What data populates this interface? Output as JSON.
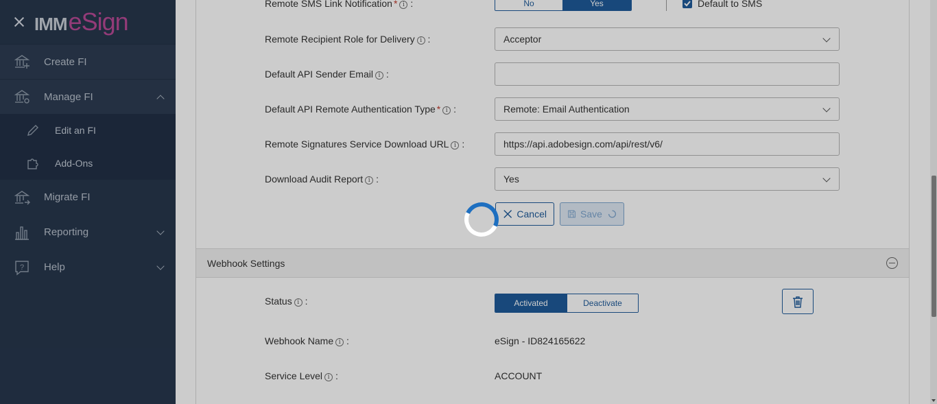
{
  "sidebar": {
    "logo_imm": "IMM",
    "logo_esign": "eSign",
    "items": [
      {
        "label": "Create FI",
        "icon": "bank-plus-icon"
      },
      {
        "label": "Manage FI",
        "icon": "bank-gear-icon"
      },
      {
        "label": "Edit an FI",
        "icon": "pencil-icon"
      },
      {
        "label": "Add-Ons",
        "icon": "puzzle-icon"
      },
      {
        "label": "Migrate FI",
        "icon": "bank-arrow-icon"
      },
      {
        "label": "Reporting",
        "icon": "bar-chart-icon"
      },
      {
        "label": "Help",
        "icon": "help-icon"
      }
    ]
  },
  "form": {
    "sms_label": "Remote SMS Link Notification",
    "sms_no": "No",
    "sms_yes": "Yes",
    "default_sms_label": "Default to SMS",
    "role_label": "Remote Recipient Role for Delivery",
    "role_value": "Acceptor",
    "sender_label": "Default API Sender Email",
    "sender_value": "",
    "auth_label": "Default API Remote Authentication Type",
    "auth_value": "Remote: Email Authentication",
    "url_label": "Remote Signatures Service Download URL",
    "url_value": "https://api.adobesign.com/api/rest/v6/",
    "audit_label": "Download Audit Report",
    "audit_value": "Yes",
    "cancel": "Cancel",
    "save": "Save",
    "colon": ":",
    "required": "*",
    "info": "i"
  },
  "webhook": {
    "title": "Webhook Settings",
    "status_label": "Status",
    "activated": "Activated",
    "deactivate": "Deactivate",
    "name_label": "Webhook Name",
    "name_value": "eSign - ID824165622",
    "level_label": "Service Level",
    "level_value": "ACCOUNT"
  },
  "colors": {
    "sidebar": "#27374d",
    "accent": "#1e5b9a",
    "brand": "#b84a96"
  }
}
